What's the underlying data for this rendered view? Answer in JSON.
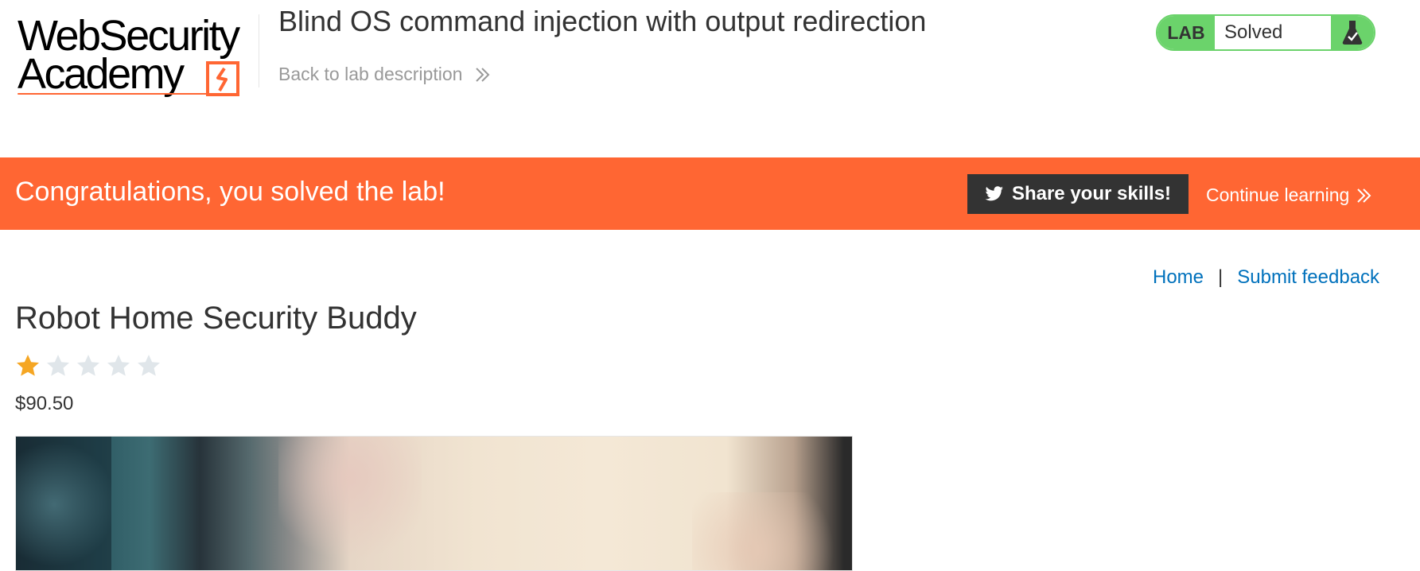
{
  "header": {
    "logo_line1": "WebSecurity",
    "logo_line2": "Academy",
    "lab_title": "Blind OS command injection with output redirection",
    "back_link": "Back to lab description",
    "badge": {
      "tag": "LAB",
      "status": "Solved",
      "icon": "flask-check-icon"
    },
    "colors": {
      "accent": "#ff6633",
      "solved_green": "#6bd36b"
    }
  },
  "banner": {
    "message": "Congratulations, you solved the lab!",
    "share_label": "Share your skills!",
    "share_icon": "twitter-bird-icon",
    "continue_label": "Continue learning"
  },
  "nav": {
    "home": "Home",
    "separator": "|",
    "feedback": "Submit feedback"
  },
  "product": {
    "name": "Robot Home Security Buddy",
    "rating": 1,
    "rating_max": 5,
    "price": "$90.50"
  }
}
